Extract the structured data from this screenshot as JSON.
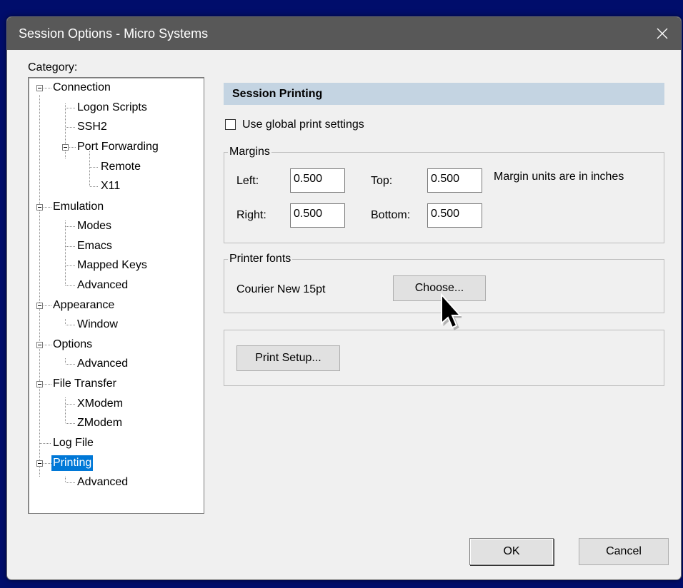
{
  "window": {
    "title": "Session Options - Micro Systems"
  },
  "category": {
    "label": "Category:",
    "tree": [
      {
        "label": "Connection",
        "level": 0,
        "expanded": true
      },
      {
        "label": "Logon Scripts",
        "level": 1
      },
      {
        "label": "SSH2",
        "level": 1
      },
      {
        "label": "Port Forwarding",
        "level": 1,
        "expanded": true
      },
      {
        "label": "Remote",
        "level": 2
      },
      {
        "label": "X11",
        "level": 2
      },
      {
        "label": "Emulation",
        "level": 0,
        "expanded": true
      },
      {
        "label": "Modes",
        "level": 1
      },
      {
        "label": "Emacs",
        "level": 1
      },
      {
        "label": "Mapped Keys",
        "level": 1
      },
      {
        "label": "Advanced",
        "level": 1
      },
      {
        "label": "Appearance",
        "level": 0,
        "expanded": true
      },
      {
        "label": "Window",
        "level": 1
      },
      {
        "label": "Options",
        "level": 0,
        "expanded": true
      },
      {
        "label": "Advanced",
        "level": 1
      },
      {
        "label": "File Transfer",
        "level": 0,
        "expanded": true
      },
      {
        "label": "XModem",
        "level": 1
      },
      {
        "label": "ZModem",
        "level": 1
      },
      {
        "label": "Log File",
        "level": 0
      },
      {
        "label": "Printing",
        "level": 0,
        "expanded": true,
        "selected": true
      },
      {
        "label": "Advanced",
        "level": 1
      }
    ]
  },
  "panel": {
    "header": "Session Printing",
    "use_global": {
      "label": "Use global print settings",
      "checked": false
    },
    "margins": {
      "group_label": "Margins",
      "left_label": "Left:",
      "left_value": "0.500",
      "top_label": "Top:",
      "top_value": "0.500",
      "right_label": "Right:",
      "right_value": "0.500",
      "bottom_label": "Bottom:",
      "bottom_value": "0.500",
      "units_note": "Margin units are in inches"
    },
    "fonts": {
      "group_label": "Printer fonts",
      "current_font": "Courier New 15pt",
      "choose_label": "Choose..."
    },
    "print_setup_label": "Print Setup..."
  },
  "footer": {
    "ok_label": "OK",
    "cancel_label": "Cancel"
  },
  "colors": {
    "selection": "#0078d7",
    "header_bg": "#c4d4e2",
    "titlebar": "#585858",
    "desktop": "#000d6b"
  }
}
